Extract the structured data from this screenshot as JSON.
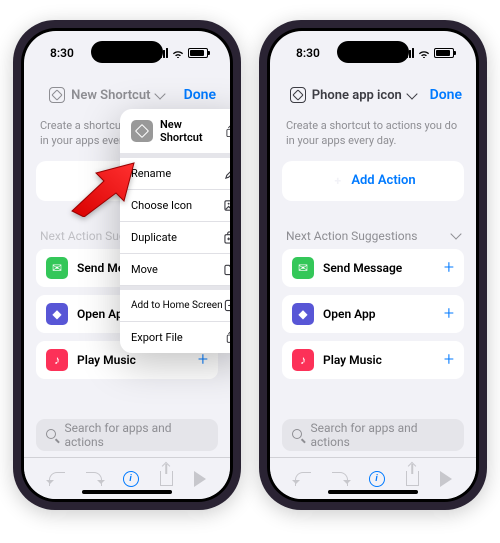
{
  "status": {
    "time": "8:30"
  },
  "left": {
    "nav_title": "New Shortcut",
    "done": "Done",
    "hint": "Create a shortcut to actions you do in your apps every day.",
    "popover": {
      "title": "New Shortcut",
      "items": [
        {
          "label": "Rename",
          "icon": "pencil"
        },
        {
          "label": "Choose Icon",
          "icon": "photo"
        },
        {
          "label": "Duplicate",
          "icon": "copy"
        },
        {
          "label": "Move",
          "icon": "folder"
        },
        {
          "label": "Add to Home Screen",
          "icon": "add-home"
        },
        {
          "label": "Export File",
          "icon": "export"
        }
      ]
    },
    "suggestions_title": "Next Action Suggestions",
    "suggestions": [
      {
        "label": "Send Message",
        "color": "#34c759"
      },
      {
        "label": "Open App",
        "color": "#5856d6"
      },
      {
        "label": "Play Music",
        "color": "#fc3158"
      }
    ],
    "search_placeholder": "Search for apps and actions"
  },
  "right": {
    "nav_title": "Phone app icon",
    "done": "Done",
    "hint": "Create a shortcut to actions you do in your apps every day.",
    "add_action": "Add Action",
    "suggestions_title": "Next Action Suggestions",
    "suggestions": [
      {
        "label": "Send Message",
        "color": "#34c759"
      },
      {
        "label": "Open App",
        "color": "#5856d6"
      },
      {
        "label": "Play Music",
        "color": "#fc3158"
      }
    ],
    "search_placeholder": "Search for apps and actions"
  }
}
